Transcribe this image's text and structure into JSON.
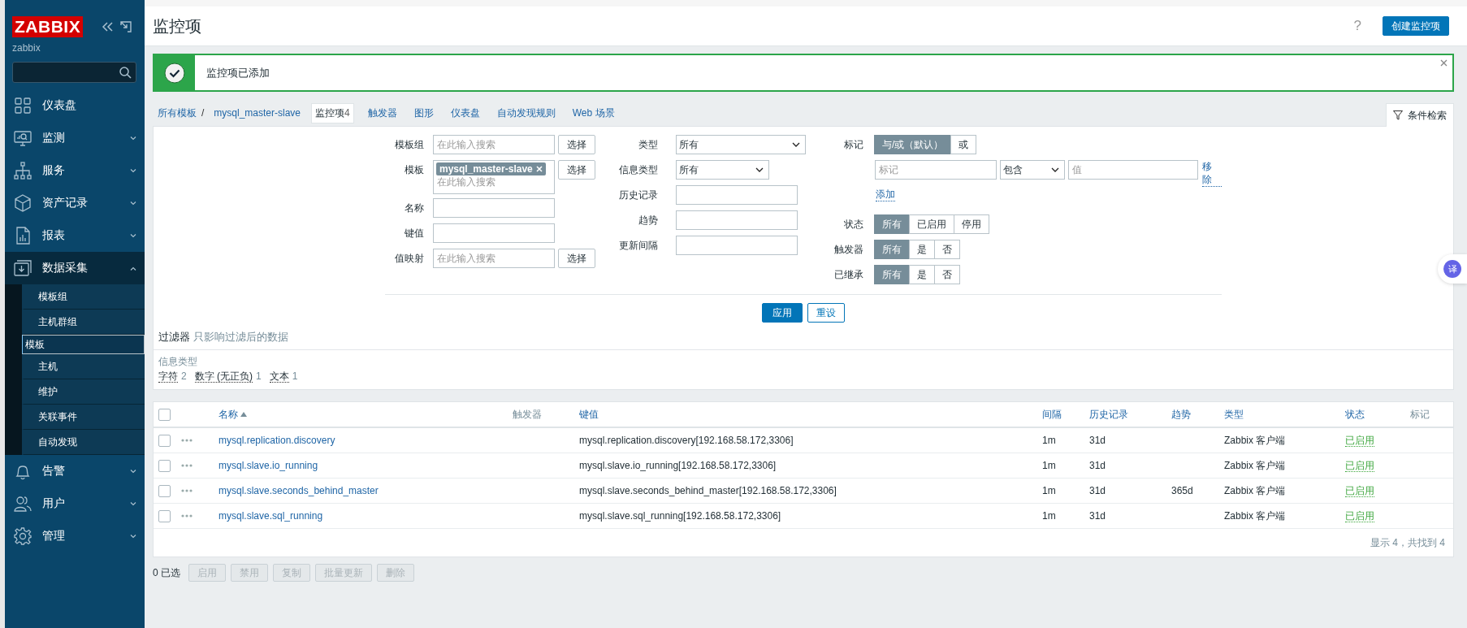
{
  "sidebar": {
    "logo": "ZABBIX",
    "server": "zabbix",
    "menu": [
      {
        "label": "仪表盘",
        "expanded": false,
        "has_arrow": false
      },
      {
        "label": "监测",
        "expanded": false,
        "has_arrow": true
      },
      {
        "label": "服务",
        "expanded": false,
        "has_arrow": true
      },
      {
        "label": "资产记录",
        "expanded": false,
        "has_arrow": true
      },
      {
        "label": "报表",
        "expanded": false,
        "has_arrow": true
      },
      {
        "label": "数据采集",
        "expanded": true,
        "has_arrow": true,
        "children": [
          {
            "label": "模板组",
            "selected": false
          },
          {
            "label": "主机群组",
            "selected": false
          },
          {
            "label": "模板",
            "selected": true
          },
          {
            "label": "主机",
            "selected": false
          },
          {
            "label": "维护",
            "selected": false
          },
          {
            "label": "关联事件",
            "selected": false
          },
          {
            "label": "自动发现",
            "selected": false
          }
        ]
      },
      {
        "label": "告警",
        "expanded": false,
        "has_arrow": true
      },
      {
        "label": "用户",
        "expanded": false,
        "has_arrow": true
      },
      {
        "label": "管理",
        "expanded": false,
        "has_arrow": true
      }
    ]
  },
  "header": {
    "title": "监控项",
    "help": "?",
    "create_button": "创建监控项"
  },
  "message": {
    "kind": "success",
    "text": "监控项已添加"
  },
  "breadcrumbs": [
    "所有模板",
    "mysql_master-slave"
  ],
  "breadcrumb_separator": "/",
  "tabs": [
    {
      "label": "监控项",
      "count": "4",
      "selected": true
    },
    {
      "label": "触发器",
      "selected": false
    },
    {
      "label": "图形",
      "selected": false
    },
    {
      "label": "仪表盘",
      "selected": false
    },
    {
      "label": "自动发现规则",
      "selected": false
    },
    {
      "label": "Web 场景",
      "selected": false
    }
  ],
  "filter_tab": {
    "label": "条件检索",
    "selected": true
  },
  "filter": {
    "col1": [
      {
        "label": "模板组",
        "kind": "multiselect",
        "placeholder": "在此输入搜索",
        "button": "选择"
      },
      {
        "label": "模板",
        "kind": "multiselect",
        "tags": [
          "mysql_master-slave"
        ],
        "placeholder": "在此输入搜索",
        "button": "选择"
      },
      {
        "label": "名称",
        "kind": "text"
      },
      {
        "label": "键值",
        "kind": "text"
      },
      {
        "label": "值映射",
        "kind": "multiselect",
        "placeholder": "在此输入搜索",
        "button": "选择"
      }
    ],
    "col2": [
      {
        "label": "类型",
        "kind": "select",
        "value": "所有",
        "wide": true
      },
      {
        "label": "信息类型",
        "kind": "select",
        "value": "所有",
        "wide": false
      },
      {
        "label": "历史记录",
        "kind": "text"
      },
      {
        "label": "趋势",
        "kind": "text"
      },
      {
        "label": "更新间隔",
        "kind": "text"
      }
    ],
    "tags": {
      "label": "标记",
      "operators": [
        {
          "label": "与/或（默认）",
          "selected": true
        },
        {
          "label": "或",
          "selected": false
        }
      ],
      "tag_placeholder": "标记",
      "operator": "包含",
      "value_placeholder": "值",
      "remove": "移除",
      "add": "添加"
    },
    "radios": [
      {
        "label": "状态",
        "options": [
          {
            "label": "所有",
            "selected": true
          },
          {
            "label": "已启用",
            "selected": false
          },
          {
            "label": "停用",
            "selected": false
          }
        ]
      },
      {
        "label": "触发器",
        "options": [
          {
            "label": "所有",
            "selected": true
          },
          {
            "label": "是",
            "selected": false
          },
          {
            "label": "否",
            "selected": false
          }
        ]
      },
      {
        "label": "已继承",
        "options": [
          {
            "label": "所有",
            "selected": true
          },
          {
            "label": "是",
            "selected": false
          },
          {
            "label": "否",
            "selected": false
          }
        ]
      }
    ],
    "apply": "应用",
    "reset": "重设"
  },
  "summary": {
    "title": "过滤器",
    "note": "只影响过滤后的数据",
    "group": "信息类型",
    "counts": [
      {
        "label": "字符",
        "count": "2"
      },
      {
        "label": "数字 (无正负)",
        "count": "1"
      },
      {
        "label": "文本",
        "count": "1"
      }
    ]
  },
  "table": {
    "select_all_checked": false,
    "columns": [
      {
        "label": "名称",
        "sortable": true,
        "sorted": true
      },
      {
        "label": "触发器",
        "sortable": false,
        "sorted": false
      },
      {
        "label": "键值",
        "sortable": true,
        "sorted": false
      },
      {
        "label": "间隔",
        "sortable": true,
        "sorted": false
      },
      {
        "label": "历史记录",
        "sortable": true,
        "sorted": false
      },
      {
        "label": "趋势",
        "sortable": true,
        "sorted": false
      },
      {
        "label": "类型",
        "sortable": true,
        "sorted": false
      },
      {
        "label": "状态",
        "sortable": true,
        "sorted": false
      },
      {
        "label": "标记",
        "sortable": false,
        "sorted": false
      }
    ],
    "rows": [
      {
        "checked": false,
        "name": "mysql.replication.discovery",
        "key": "mysql.replication.discovery[192.168.58.172,3306]",
        "interval": "1m",
        "history": "31d",
        "type": "Zabbix 客户端",
        "status": "已启用",
        "enabled": true
      },
      {
        "checked": false,
        "name": "mysql.slave.io_running",
        "key": "mysql.slave.io_running[192.168.58.172,3306]",
        "interval": "1m",
        "history": "31d",
        "type": "Zabbix 客户端",
        "status": "已启用",
        "enabled": true
      },
      {
        "checked": false,
        "name": "mysql.slave.seconds_behind_master",
        "key": "mysql.slave.seconds_behind_master[192.168.58.172,3306]",
        "interval": "1m",
        "history": "31d",
        "trend": "365d",
        "type": "Zabbix 客户端",
        "status": "已启用",
        "enabled": true
      },
      {
        "checked": false,
        "name": "mysql.slave.sql_running",
        "key": "mysql.slave.sql_running[192.168.58.172,3306]",
        "interval": "1m",
        "history": "31d",
        "type": "Zabbix 客户端",
        "status": "已启用",
        "enabled": true
      }
    ],
    "footer": "显示 4，共找到 4"
  },
  "actions": {
    "selected_count": "0 已选",
    "buttons": [
      {
        "label": "启用",
        "disabled": true
      },
      {
        "label": "禁用",
        "disabled": true
      },
      {
        "label": "复制",
        "disabled": true
      },
      {
        "label": "批量更新",
        "disabled": true
      },
      {
        "label": "删除",
        "disabled": true
      }
    ]
  },
  "translate_widget": {
    "label": "译"
  }
}
